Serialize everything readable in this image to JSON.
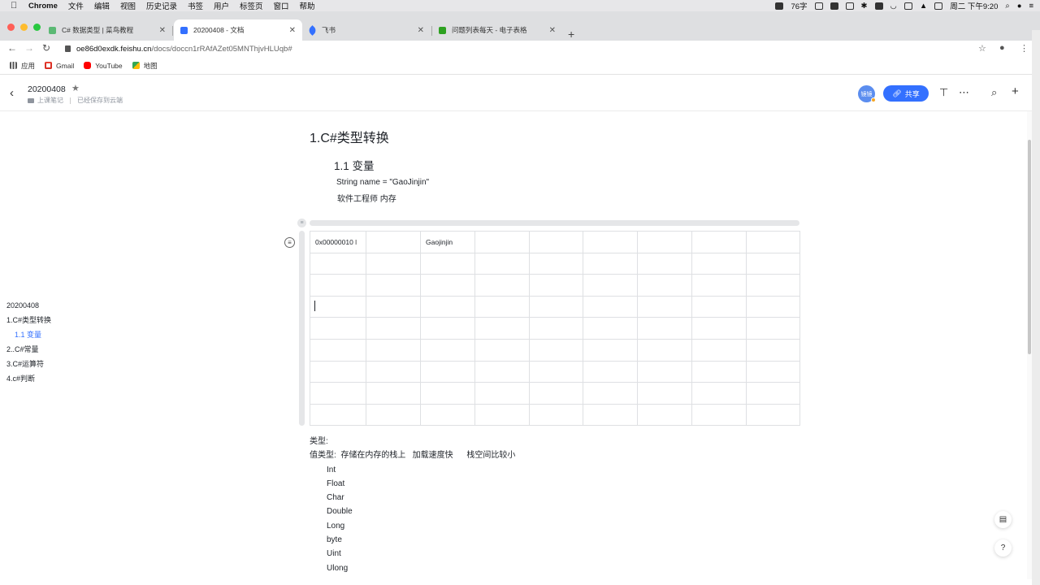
{
  "menubar": {
    "app_name": "Chrome",
    "items": [
      "文件",
      "编辑",
      "视图",
      "历史记录",
      "书签",
      "用户",
      "标签页",
      "窗口",
      "帮助"
    ],
    "word_count": "76字",
    "clock": "周二 下午9:20"
  },
  "tabs": [
    {
      "label": "C# 数据类型 | 菜鸟教程",
      "icon_color": "#5bb974",
      "active": false
    },
    {
      "label": "20200408 - 文档",
      "icon_color": "#3370ff",
      "active": true
    },
    {
      "label": "飞书",
      "icon_color": "#3370ff",
      "active": false
    },
    {
      "label": "问题列表每天 - 电子表格",
      "icon_color": "#2ea121",
      "active": false
    }
  ],
  "address": {
    "host": "oe86d0exdk.feishu.cn",
    "path": "/docs/doccn1rRAfAZet05MNThjvHLUqb#"
  },
  "bookmarks": [
    "应用",
    "Gmail",
    "YouTube",
    "地图"
  ],
  "doc_header": {
    "title": "20200408",
    "folder": "上课笔记",
    "save_status": "已经保存到云端",
    "avatar_text": "镜镜",
    "share_label": "共享"
  },
  "outline": {
    "title": "20200408",
    "items": [
      "1.C#类型转换",
      "1.1 变量",
      "2..C#常量",
      "3.C#运算符",
      "4.c#判断"
    ]
  },
  "content": {
    "h1": "1.C#类型转换",
    "h2": "1.1 变量",
    "line1": "String name = \"GaoJinjin\"",
    "line2": "软件工程师  内存",
    "table": [
      [
        "0x00000010",
        "",
        "Gaojinjin",
        "",
        "",
        "",
        "",
        "",
        ""
      ],
      [
        "",
        "",
        "",
        "",
        "",
        "",
        "",
        "",
        ""
      ],
      [
        "",
        "",
        "",
        "",
        "",
        "",
        "",
        "",
        ""
      ],
      [
        "",
        "",
        "",
        "",
        "",
        "",
        "",
        "",
        ""
      ],
      [
        "",
        "",
        "",
        "",
        "",
        "",
        "",
        "",
        ""
      ],
      [
        "",
        "",
        "",
        "",
        "",
        "",
        "",
        "",
        ""
      ],
      [
        "",
        "",
        "",
        "",
        "",
        "",
        "",
        "",
        ""
      ],
      [
        "",
        "",
        "",
        "",
        "",
        "",
        "",
        "",
        ""
      ],
      [
        "",
        "",
        "",
        "",
        "",
        "",
        "",
        "",
        ""
      ]
    ],
    "types_heading": "类型:",
    "value_types_line": "值类型:  存储在内存的栈上   加载速度快      栈空间比较小",
    "value_types": [
      "Int",
      "Float",
      "Char",
      "Double",
      "Long",
      "byte",
      "Uint",
      "Ulong"
    ]
  },
  "colors": {
    "accent": "#3370ff",
    "traffic_red": "#ff5f57",
    "traffic_yellow": "#febc2e",
    "traffic_green": "#28c840"
  }
}
